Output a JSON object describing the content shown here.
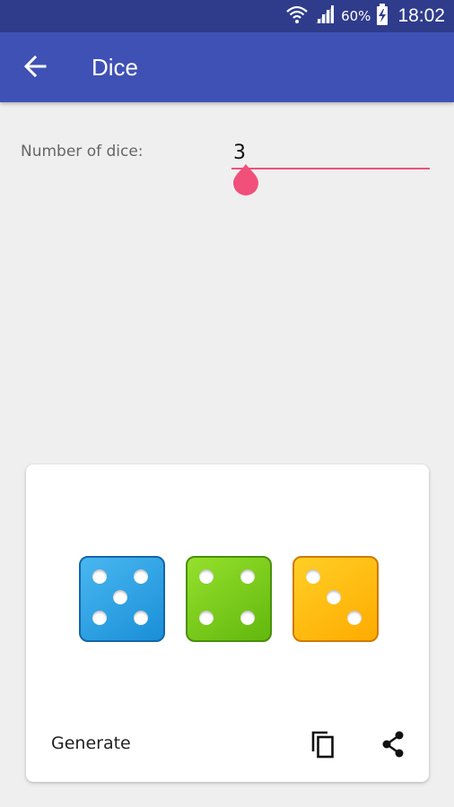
{
  "status_bar": {
    "battery_percent": "60%",
    "time": "18:02",
    "icons": [
      "wifi-icon",
      "signal-icon",
      "battery-charging-icon"
    ]
  },
  "app_bar": {
    "back_icon": "arrow-back-icon",
    "title": "Dice"
  },
  "settings": {
    "number_of_dice_label": "Number of dice:",
    "number_of_dice_value": "3"
  },
  "result_card": {
    "dice": [
      {
        "value": 5,
        "color": "#1E9BE0"
      },
      {
        "value": 4,
        "color": "#72C81A"
      },
      {
        "value": 3,
        "color": "#FFBA0F"
      }
    ],
    "generate_label": "Generate",
    "copy_icon": "copy-icon",
    "share_icon": "share-icon"
  },
  "colors": {
    "primary": "#3F51B5",
    "primary_dark": "#2F3C8C",
    "accent": "#F0507A",
    "background": "#EFEFEF"
  }
}
